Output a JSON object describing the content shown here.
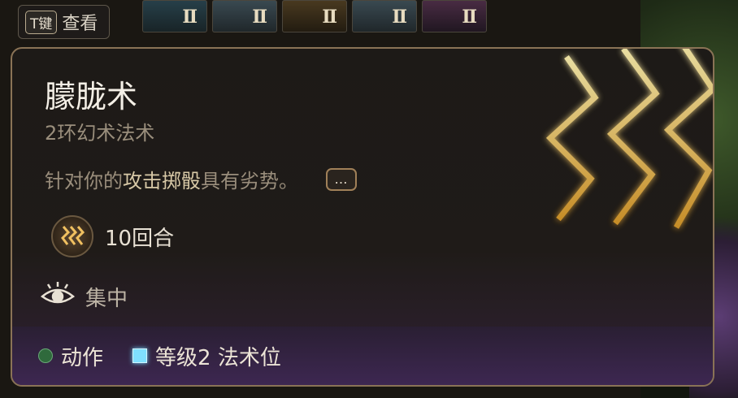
{
  "hotbar": {
    "slots": [
      {
        "rank": "II"
      },
      {
        "rank": "II"
      },
      {
        "rank": "II"
      },
      {
        "rank": "II"
      },
      {
        "rank": "II"
      }
    ]
  },
  "key_hint": {
    "key": "T键",
    "label": "查看"
  },
  "tooltip": {
    "title": "朦胧术",
    "subtitle": "2环幻术法术",
    "desc_prefix": "针对你的",
    "desc_highlight": "攻击掷骰",
    "desc_suffix": "具有劣势。",
    "more_label": "…",
    "duration": "10回合",
    "concentration": "集中",
    "cost_action": "动作",
    "cost_slot": "等级2 法术位"
  },
  "colors": {
    "border": "#8a7356",
    "action_dot": "#2f6a3c",
    "spell_slot": "#7fe0ff",
    "highlight_text": "#d8c9a7"
  },
  "icons": {
    "duration": "zigzag-rune-icon",
    "concentration": "eye-icon",
    "art": "lightning-zigzag-art"
  }
}
